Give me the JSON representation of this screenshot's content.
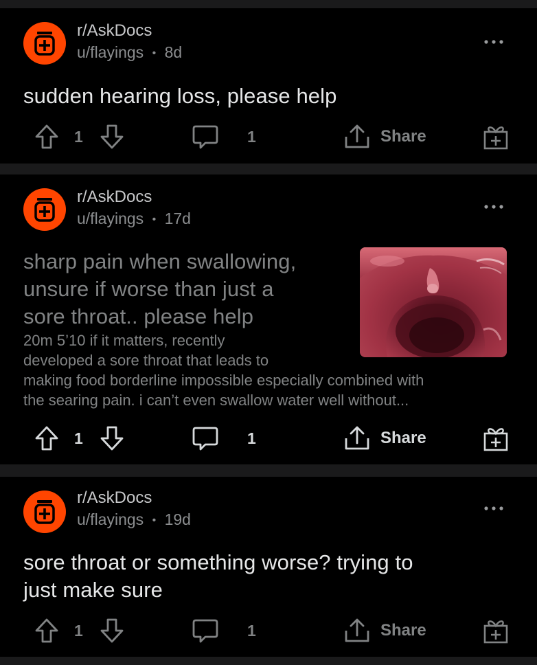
{
  "posts": [
    {
      "subreddit": "r/AskDocs",
      "author": "u/flayings",
      "separator": "•",
      "age": "8d",
      "title": "sudden hearing loss, please help",
      "votes": "1",
      "comments": "1",
      "share_label": "Share"
    },
    {
      "subreddit": "r/AskDocs",
      "author": "u/flayings",
      "separator": "•",
      "age": "17d",
      "title_lines": [
        "sharp pain when swallowing,",
        "unsure if worse than just a",
        "sore throat.. please help"
      ],
      "body_lines": [
        "20m 5’10 if it matters, recently",
        "developed a sore throat that leads to",
        "making food borderline impossible especially combined with",
        "the searing pain. i can’t even swallow water well without..."
      ],
      "votes": "1",
      "comments": "1",
      "share_label": "Share"
    },
    {
      "subreddit": "r/AskDocs",
      "author": "u/flayings",
      "separator": "•",
      "age": "19d",
      "title_lines": [
        "sore throat or something worse? trying to",
        "just make sure"
      ],
      "votes": "1",
      "comments": "1",
      "share_label": "Share"
    }
  ],
  "icons": {
    "avatar": "medicine-bottle-icon",
    "more": "more-options-icon",
    "upvote": "upvote-arrow-icon",
    "downvote": "downvote-arrow-icon",
    "comment": "comment-bubble-icon",
    "share": "share-icon",
    "award": "award-gift-icon"
  },
  "colors": {
    "background": "#000000",
    "divider": "#1a1a1b",
    "accent": "#ff4500",
    "text_primary": "#e6e7e8",
    "text_secondary": "#818384"
  }
}
